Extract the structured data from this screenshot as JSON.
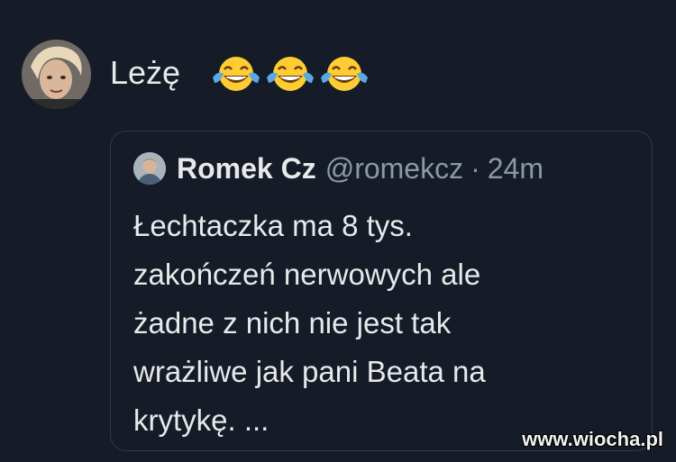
{
  "author": {
    "avatar": "user-avatar"
  },
  "tweet": {
    "text": "Leżę",
    "emojis": [
      "face-with-tears-of-joy-icon",
      "face-with-tears-of-joy-icon",
      "face-with-tears-of-joy-icon"
    ]
  },
  "quoted": {
    "name": "Romek Cz",
    "handle": "@romekcz",
    "separator": "·",
    "time": "24m",
    "lines": [
      "Łechtaczka ma 8 tys.",
      "zakończeń nerwowych ale",
      "żadne z nich nie jest tak",
      "wrażliwe jak pani Beata na",
      "krytykę. ..."
    ]
  },
  "watermark": "www.wiocha.pl",
  "colors": {
    "background": "#161c27",
    "text": "#e7e9ea",
    "muted": "#8b98a5",
    "border": "#2f3945",
    "emoji_yellow": "#ffcc33",
    "emoji_tears": "#5aa9e6"
  }
}
